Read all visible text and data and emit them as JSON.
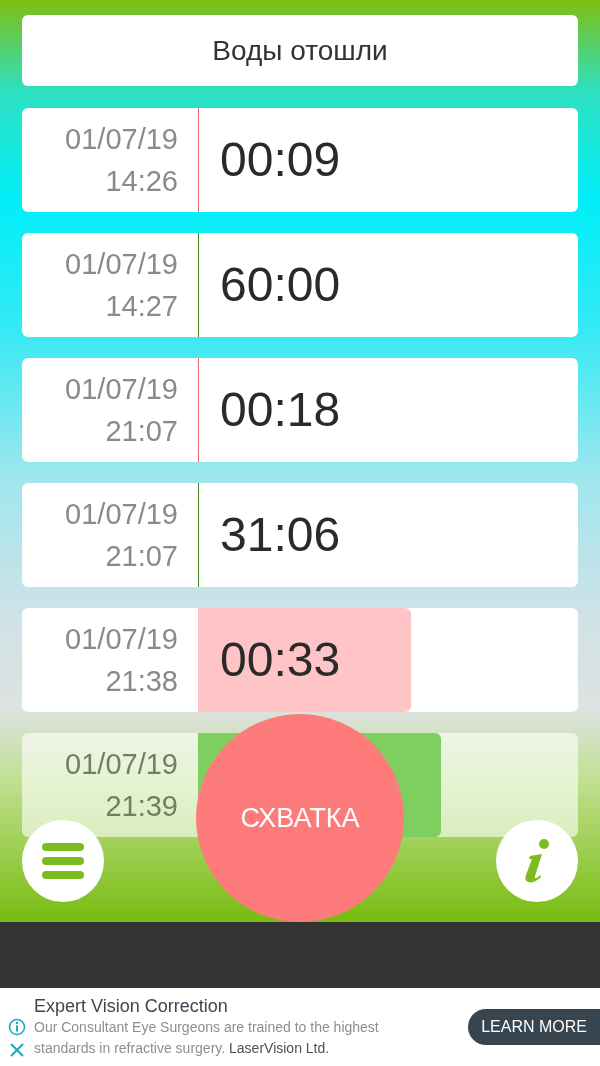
{
  "header_button": "Воды отошли",
  "rows": [
    {
      "date": "01/07/19",
      "time": "14:26",
      "duration": "00:09",
      "kind": "contraction"
    },
    {
      "date": "01/07/19",
      "time": "14:27",
      "duration": "60:00",
      "kind": "rest"
    },
    {
      "date": "01/07/19",
      "time": "21:07",
      "duration": "00:18",
      "kind": "contraction"
    },
    {
      "date": "01/07/19",
      "time": "21:07",
      "duration": "31:06",
      "kind": "rest"
    },
    {
      "date": "01/07/19",
      "time": "21:38",
      "duration": "00:33",
      "kind": "contraction",
      "level": 0.56
    },
    {
      "date": "01/07/19",
      "time": "21:39",
      "kind": "rest"
    }
  ],
  "main_button": "СХВАТКА",
  "ad": {
    "title": "Expert Vision Correction",
    "body": "Our Consultant Eye Surgeons are trained to the highest standards in refractive surgery.",
    "advertiser": "LaserVision Ltd.",
    "button": "LEARN MORE"
  }
}
